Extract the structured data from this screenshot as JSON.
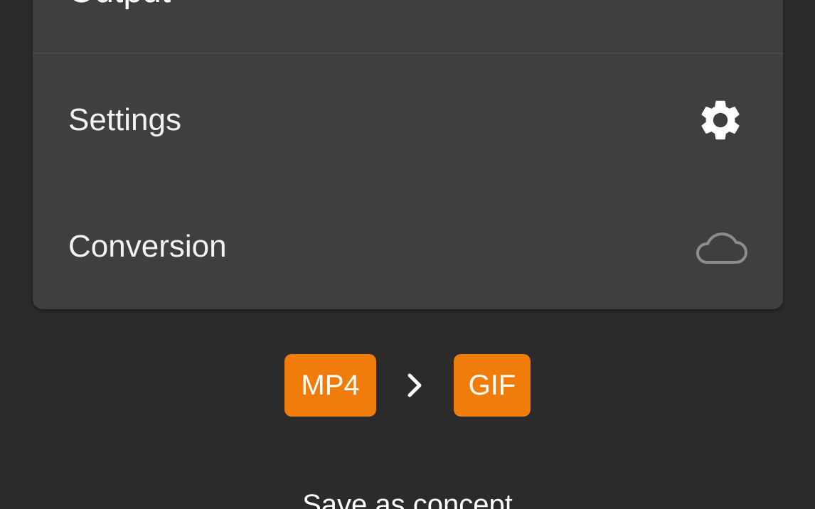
{
  "card": {
    "title": "Output",
    "rows": [
      {
        "label": "Settings",
        "icon": "gear-icon"
      },
      {
        "label": "Conversion",
        "icon": "cloud-icon"
      }
    ]
  },
  "format": {
    "from": "MP4",
    "to": "GIF",
    "separator_icon": "chevron-right-icon",
    "badge_color": "#f07c0c"
  },
  "footer": {
    "save_label": "Save as concept"
  }
}
